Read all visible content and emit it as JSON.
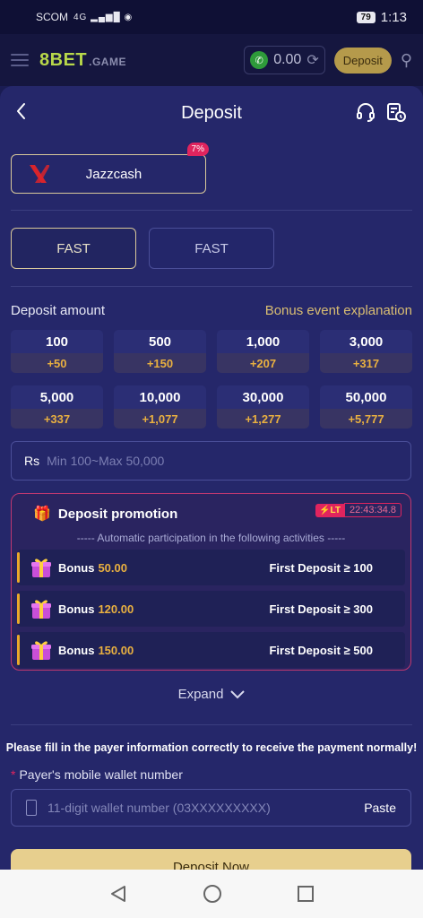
{
  "status_bar": {
    "carrier": "SCOM",
    "signal": "4G",
    "battery": "79",
    "time": "1:13"
  },
  "top_bar": {
    "logo": "8BET",
    "logo_suffix": ".GAME",
    "balance": "0.00",
    "deposit_label": "Deposit"
  },
  "page": {
    "title": "Deposit"
  },
  "payment_method": {
    "label": "Jazzcash",
    "badge": "7%"
  },
  "channels": [
    {
      "label": "FAST",
      "selected": true
    },
    {
      "label": "FAST",
      "selected": false
    }
  ],
  "amount_section": {
    "label": "Deposit amount",
    "bonus_link": "Bonus event explanation"
  },
  "amounts": [
    {
      "value": "100",
      "bonus": "+50"
    },
    {
      "value": "500",
      "bonus": "+150"
    },
    {
      "value": "1,000",
      "bonus": "+207"
    },
    {
      "value": "3,000",
      "bonus": "+317"
    },
    {
      "value": "5,000",
      "bonus": "+337"
    },
    {
      "value": "10,000",
      "bonus": "+1,077"
    },
    {
      "value": "30,000",
      "bonus": "+1,277"
    },
    {
      "value": "50,000",
      "bonus": "+5,777"
    }
  ],
  "amount_input": {
    "currency": "Rs",
    "placeholder": "Min 100~Max 50,000"
  },
  "promotion": {
    "title": "Deposit promotion",
    "tag": "LT",
    "timer": "22:43:34.8",
    "subtitle": "----- Automatic participation in the following activities -----",
    "rows": [
      {
        "label": "Bonus",
        "amount": "50.00",
        "condition": "First Deposit ≥ 100"
      },
      {
        "label": "Bonus",
        "amount": "120.00",
        "condition": "First Deposit ≥ 300"
      },
      {
        "label": "Bonus",
        "amount": "150.00",
        "condition": "First Deposit ≥ 500"
      }
    ],
    "expand_label": "Expand"
  },
  "payer": {
    "notice": "Please fill in the payer information correctly to receive the payment normally!",
    "required_mark": "*",
    "field_label": "Payer's mobile wallet number",
    "placeholder": "11-digit wallet number (03XXXXXXXXX)",
    "paste_label": "Paste"
  },
  "cta": {
    "label": "Deposit Now"
  },
  "colors": {
    "accent_gold": "#d9bd72",
    "bonus_orange": "#e9b040",
    "badge_red": "#e0245e",
    "sheet_bg": "#25276a"
  }
}
